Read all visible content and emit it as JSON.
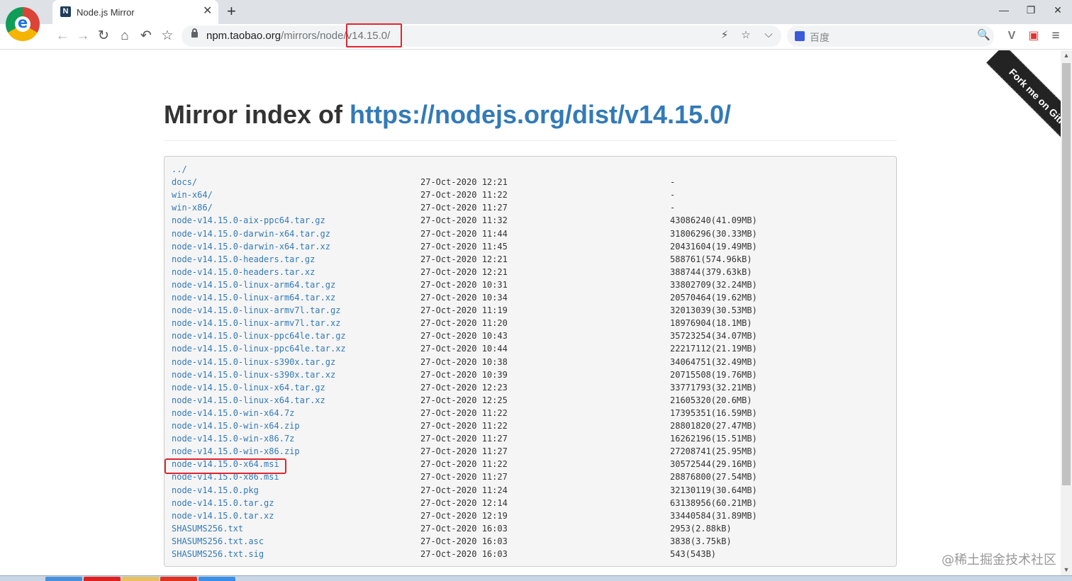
{
  "window": {
    "tab_title": "Node.js Mirror",
    "tab_favicon": "N",
    "new_tab": "+",
    "tab_close": "✕",
    "minimize": "—",
    "maximize": "❐",
    "close": "✕"
  },
  "toolbar": {
    "back": "←",
    "forward": "→",
    "reload": "↻",
    "home": "⌂",
    "undo": "↶",
    "bookmark": "☆",
    "url_host": "npm.taobao.org",
    "url_path": "/mirrors/node/v14.15.0/",
    "flash": "⚡",
    "star": "☆",
    "dropdown": "⌵",
    "search_placeholder": "百度",
    "search_icon": "🔍",
    "ext_v": "V",
    "ext_pdf": "▣",
    "menu": "≡"
  },
  "page": {
    "heading_prefix": "Mirror index of ",
    "heading_link": "https://nodejs.org/dist/v14.15.0/",
    "ribbon": "Fork me on GitHub",
    "watermark": "@稀土掘金技术社区"
  },
  "listing": [
    {
      "name": "../",
      "date": "",
      "size": ""
    },
    {
      "name": "docs/",
      "date": "27-Oct-2020 12:21",
      "size": "-"
    },
    {
      "name": "win-x64/",
      "date": "27-Oct-2020 11:22",
      "size": "-"
    },
    {
      "name": "win-x86/",
      "date": "27-Oct-2020 11:27",
      "size": "-"
    },
    {
      "name": "node-v14.15.0-aix-ppc64.tar.gz",
      "date": "27-Oct-2020 11:32",
      "size": "43086240(41.09MB)"
    },
    {
      "name": "node-v14.15.0-darwin-x64.tar.gz",
      "date": "27-Oct-2020 11:44",
      "size": "31806296(30.33MB)"
    },
    {
      "name": "node-v14.15.0-darwin-x64.tar.xz",
      "date": "27-Oct-2020 11:45",
      "size": "20431604(19.49MB)"
    },
    {
      "name": "node-v14.15.0-headers.tar.gz",
      "date": "27-Oct-2020 12:21",
      "size": "588761(574.96kB)"
    },
    {
      "name": "node-v14.15.0-headers.tar.xz",
      "date": "27-Oct-2020 12:21",
      "size": "388744(379.63kB)"
    },
    {
      "name": "node-v14.15.0-linux-arm64.tar.gz",
      "date": "27-Oct-2020 10:31",
      "size": "33802709(32.24MB)"
    },
    {
      "name": "node-v14.15.0-linux-arm64.tar.xz",
      "date": "27-Oct-2020 10:34",
      "size": "20570464(19.62MB)"
    },
    {
      "name": "node-v14.15.0-linux-armv7l.tar.gz",
      "date": "27-Oct-2020 11:19",
      "size": "32013039(30.53MB)"
    },
    {
      "name": "node-v14.15.0-linux-armv7l.tar.xz",
      "date": "27-Oct-2020 11:20",
      "size": "18976904(18.1MB)"
    },
    {
      "name": "node-v14.15.0-linux-ppc64le.tar.gz",
      "date": "27-Oct-2020 10:43",
      "size": "35723254(34.07MB)"
    },
    {
      "name": "node-v14.15.0-linux-ppc64le.tar.xz",
      "date": "27-Oct-2020 10:44",
      "size": "22217112(21.19MB)"
    },
    {
      "name": "node-v14.15.0-linux-s390x.tar.gz",
      "date": "27-Oct-2020 10:38",
      "size": "34064751(32.49MB)"
    },
    {
      "name": "node-v14.15.0-linux-s390x.tar.xz",
      "date": "27-Oct-2020 10:39",
      "size": "20715508(19.76MB)"
    },
    {
      "name": "node-v14.15.0-linux-x64.tar.gz",
      "date": "27-Oct-2020 12:23",
      "size": "33771793(32.21MB)"
    },
    {
      "name": "node-v14.15.0-linux-x64.tar.xz",
      "date": "27-Oct-2020 12:25",
      "size": "21605320(20.6MB)"
    },
    {
      "name": "node-v14.15.0-win-x64.7z",
      "date": "27-Oct-2020 11:22",
      "size": "17395351(16.59MB)"
    },
    {
      "name": "node-v14.15.0-win-x64.zip",
      "date": "27-Oct-2020 11:22",
      "size": "28801820(27.47MB)"
    },
    {
      "name": "node-v14.15.0-win-x86.7z",
      "date": "27-Oct-2020 11:27",
      "size": "16262196(15.51MB)"
    },
    {
      "name": "node-v14.15.0-win-x86.zip",
      "date": "27-Oct-2020 11:27",
      "size": "27208741(25.95MB)"
    },
    {
      "name": "node-v14.15.0-x64.msi",
      "date": "27-Oct-2020 11:22",
      "size": "30572544(29.16MB)"
    },
    {
      "name": "node-v14.15.0-x86.msi",
      "date": "27-Oct-2020 11:27",
      "size": "28876800(27.54MB)"
    },
    {
      "name": "node-v14.15.0.pkg",
      "date": "27-Oct-2020 11:24",
      "size": "32130119(30.64MB)"
    },
    {
      "name": "node-v14.15.0.tar.gz",
      "date": "27-Oct-2020 12:14",
      "size": "63138956(60.21MB)"
    },
    {
      "name": "node-v14.15.0.tar.xz",
      "date": "27-Oct-2020 12:19",
      "size": "33440584(31.89MB)"
    },
    {
      "name": "SHASUMS256.txt",
      "date": "27-Oct-2020 16:03",
      "size": "2953(2.88kB)"
    },
    {
      "name": "SHASUMS256.txt.asc",
      "date": "27-Oct-2020 16:03",
      "size": "3838(3.75kB)"
    },
    {
      "name": "SHASUMS256.txt.sig",
      "date": "27-Oct-2020 16:03",
      "size": "543(543B)"
    }
  ],
  "colors": {
    "link": "#337ab7",
    "highlight": "#e0252f",
    "ribbon": "#232323"
  }
}
